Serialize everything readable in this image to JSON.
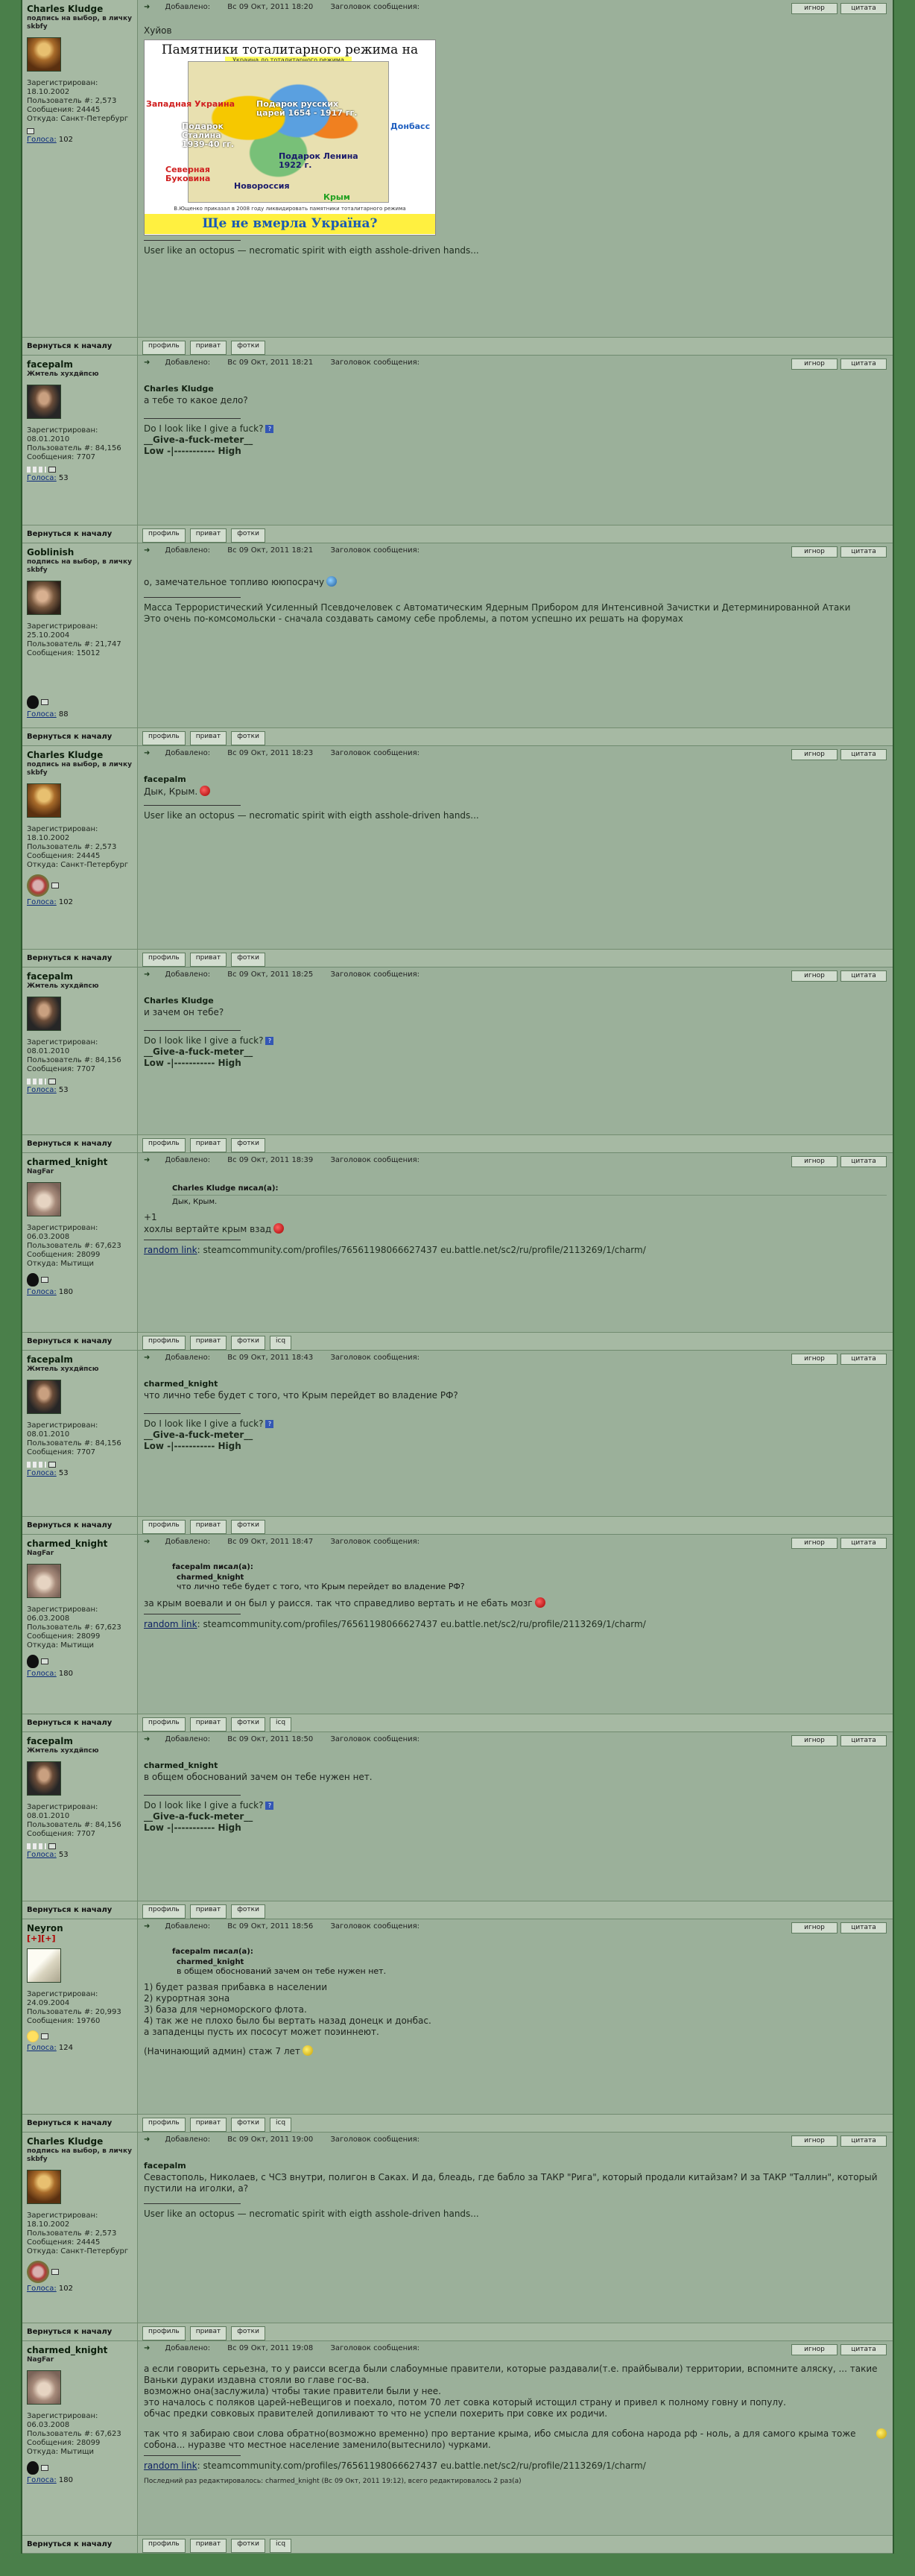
{
  "labels": {
    "added": "Добавлено:",
    "subject": "Заголовок сообщения:",
    "registered": "Зарегистрирован:",
    "user_no": "Пользователь #:",
    "messages": "Сообщения:",
    "from": "Откуда:",
    "votes": "Голоса:",
    "ignore": "игнор",
    "cite": "цитата",
    "back": "Вернуться к началу",
    "profile": "профиль",
    "pm": "приват",
    "photos": "фотки",
    "icq": "icq",
    "wrote": "писал(а):"
  },
  "sig": {
    "charles": "User like an octopus — necromatic spirit with eigth asshole-driven hands...",
    "face_q": "Do I look like I give a fuck?",
    "face_m": "__Give-a-fuck-meter__",
    "face_s": "Low -|----------- High",
    "knight_link": "random link",
    "knight_url": "steamcommunity.com/profiles/76561198066627437 eu.battle.net/sc2/ru/profile/2113269/1/charm/"
  },
  "users": {
    "charles": {
      "name": "Charles Kludge",
      "title": "подпись на выбор, в личку skbfy",
      "reg": "18.10.2002",
      "no": "2,573",
      "msgs": "24445",
      "from": "Санкт-Петербург",
      "votes": "102"
    },
    "face": {
      "name": "facepalm",
      "title": "Жмтель хухдйпсю",
      "reg": "08.01.2010",
      "no": "84,156",
      "msgs": "7707",
      "votes": "53"
    },
    "goblin": {
      "name": "Goblinish",
      "title": "подпись на выбор, в личку skbfy",
      "reg": "25.10.2004",
      "no": "21,747",
      "msgs": "15012",
      "votes": "88"
    },
    "knight": {
      "name": "charmed_knight",
      "title": "NagFar",
      "reg": "06.03.2008",
      "no": "67,623",
      "msgs": "28099",
      "from": "Мытищи",
      "votes": "180"
    },
    "neyron": {
      "name": "Neyron",
      "title": "[+][+]",
      "reg": "24.09.2004",
      "no": "20,993",
      "msgs": "19760",
      "votes": "124"
    }
  },
  "banner": {
    "title": "Памятники тоталитарного режима на Украине",
    "sub": "Украина до тоталитарного режима (1654 г.)",
    "l1": "Западная Украина",
    "l2": "Подарок Сталина 1939-40 гг.",
    "l3": "Подарок русских царей 1654 - 1917 гг.",
    "l4": "Донбасс",
    "l5": "Подарок Ленина 1922 г.",
    "l6": "Северная Буковина",
    "l7": "Новороссия",
    "l8": "Крым",
    "caption": "В.Ющенко приказал в 2008 году ликвидировать памятники тоталитарного режима",
    "bottom": "Ще не вмерла Украïна?"
  },
  "posts": [
    {
      "user": "charles",
      "date": "Вс 09 Окт, 2011 18:20",
      "lead": "Хуйов"
    },
    {
      "user": "face",
      "date": "Вс 09 Окт, 2011 18:21",
      "to": "Charles Kludge",
      "text": "а тебе то какое дело?"
    },
    {
      "user": "goblin",
      "date": "Вс 09 Окт, 2011 18:21",
      "text": "о, замечательное топливо ююпосрачу",
      "text2": "Масса Террористический Усиленный Псевдочеловек с Автоматическим Ядерным Прибором для Интенсивной Зачистки и Детерминированной Атаки",
      "text3": "Это очень по-комсомольски - сначала создавать самому себе проблемы, а потом успешно их решать на форумах"
    },
    {
      "user": "charles",
      "date": "Вс 09 Окт, 2011 18:23",
      "to": "facepalm",
      "text": "Дык, Крым."
    },
    {
      "user": "face",
      "date": "Вс 09 Окт, 2011 18:25",
      "to": "Charles Kludge",
      "text": "и зачем он тебе?"
    },
    {
      "user": "knight",
      "date": "Вс 09 Окт, 2011 18:39",
      "qname": "Charles Kludge",
      "qtext": "Дык, Крым.",
      "l1": "+1",
      "l2": "хохлы вертайте крым взад"
    },
    {
      "user": "face",
      "date": "Вс 09 Окт, 2011 18:43",
      "to": "charmed_knight",
      "text": "что лично тебе будет с того, что Крым перейдет во владение РФ?"
    },
    {
      "user": "knight",
      "date": "Вс 09 Окт, 2011 18:47",
      "qname": "facepalm",
      "qinner": "charmed_knight",
      "qtext": "что лично тебе будет с того, что Крым перейдет во владение РФ?",
      "l1": "за крым воевали и он был у раисся. так что справедливо вертать и не ебать мозг"
    },
    {
      "user": "face",
      "date": "Вс 09 Окт, 2011 18:50",
      "to": "charmed_knight",
      "text": "в общем обоснований зачем он тебе нужен нет."
    },
    {
      "user": "neyron",
      "date": "Вс 09 Окт, 2011 18:56",
      "qname": "facepalm",
      "qinner": "charmed_knight",
      "qtext": "в общем обоснований зачем он тебе нужен нет.",
      "lines": [
        "1) будет развая прибавка в населении",
        "2) курортная зона",
        "3) база для черноморского флота.",
        "4) так же не плохо было бы вертать назад донецк и донбас.",
        "а западенцы пусть их пососут может поэиннеют."
      ],
      "tail": "(Начинающий админ) стаж 7 лет"
    },
    {
      "user": "charles",
      "date": "Вс 09 Окт, 2011 19:00",
      "to": "facepalm",
      "text": "Севастополь, Николаев, с ЧСЗ внутри, полигон в Саках. И да, блеадь, где бабло за ТАКР \"Рига\", который продали китайзам? И за ТАКР \"Таллин\", который пустили на иголки, а?"
    },
    {
      "user": "knight",
      "date": "Вс 09 Окт, 2011 19:08",
      "lines": [
        "а если говорить серьезна, то у раисси всегда были слабоумные правители, которые раздавали(т.е. прайбывали) территории, вспомните аляску, ... такие Ваньки дураки издавна стояли во главе гос-ва.",
        "возможно она(заслужила) чтобы такие правители были у нее.",
        "это началось с поляков царей-неВещигов и поехало, потом 70 лет совка который истощил страну и привел к полному говну и популу.",
        "обчас предки совковых правителей допиливают то что не успели похерить при совке их родичи.",
        "",
        "так что я забираю свои слова обратно(возможно временно) про вертание крыма, ибо смысла для собона народа рф - ноль, а для самого крыма тоже собона... нуразве что местное население заменило(вытеснило) чурками."
      ],
      "edited": "Последний раз редактировалось: charmed_knight (Вс 09 Окт, 2011 19:12), всего редактировалось 2 раз(а)"
    }
  ]
}
